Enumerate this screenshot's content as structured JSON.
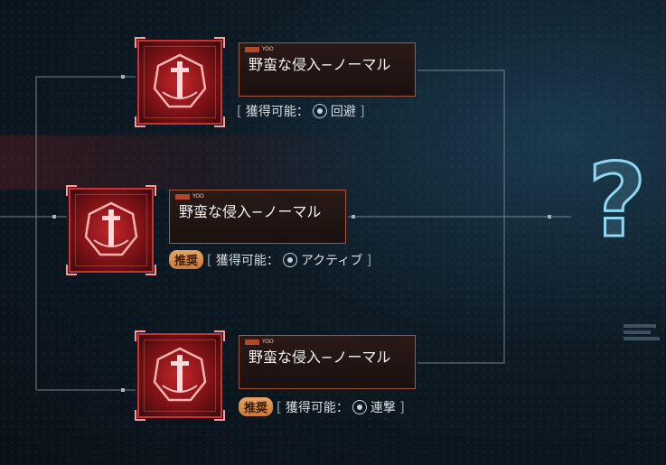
{
  "nodes": [
    {
      "tag": "YOO",
      "title": "野蛮な侵入−ノーマル",
      "badge": "",
      "acquire_label": "獲得可能：",
      "acquire_skill": "回避",
      "icon": "dodge-icon"
    },
    {
      "tag": "YOO",
      "title": "野蛮な侵入−ノーマル",
      "badge": "推奨",
      "acquire_label": "獲得可能：",
      "acquire_skill": "アクティブ",
      "icon": "active-icon"
    },
    {
      "tag": "YOO",
      "title": "野蛮な侵入−ノーマル",
      "badge": "推奨",
      "acquire_label": "獲得可能：",
      "acquire_skill": "連撃",
      "icon": "combo-icon"
    }
  ],
  "mystery": {
    "symbol": "?"
  },
  "colors": {
    "node_red": "#c2252a",
    "card_border": "#a8563a",
    "badge": "#e7a564",
    "mystery": "#8fd7f0"
  }
}
